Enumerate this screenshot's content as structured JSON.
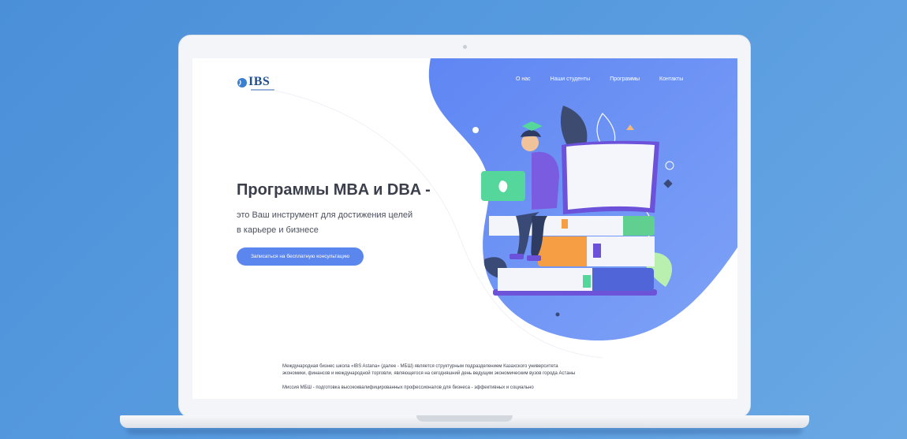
{
  "logo": {
    "text": "IBS"
  },
  "nav": [
    {
      "label": "О нас"
    },
    {
      "label": "Наши студенты"
    },
    {
      "label": "Программы"
    },
    {
      "label": "Контакты"
    }
  ],
  "hero": {
    "title": "Программы MBA и DBA -",
    "subtitle": "это Ваш инструмент для достижения целей в карьере и бизнесе",
    "cta_label": "Записаться на бесплатную консультацию"
  },
  "about": {
    "paragraph1": "Международная бизнес школа «IBS Astana» (далее - МБШ) является структурным подразделением Казахского университета экономики, финансов и международной торговли, являющегося на сегодняшний день ведущим экономическим вузов города Астаны",
    "paragraph2": "Миссия МБШ - подготовка высококвалифицированных профессионалов для бизнеса - эффективных и социально"
  },
  "colors": {
    "accent": "#5b86ee",
    "blob": "#6b8ff5",
    "brand": "#1e4f8f",
    "background": "#4a8fd8"
  },
  "icons": [
    "globe-icon",
    "student-illustration",
    "laptop-icon",
    "books-stack",
    "leaf-icon"
  ]
}
